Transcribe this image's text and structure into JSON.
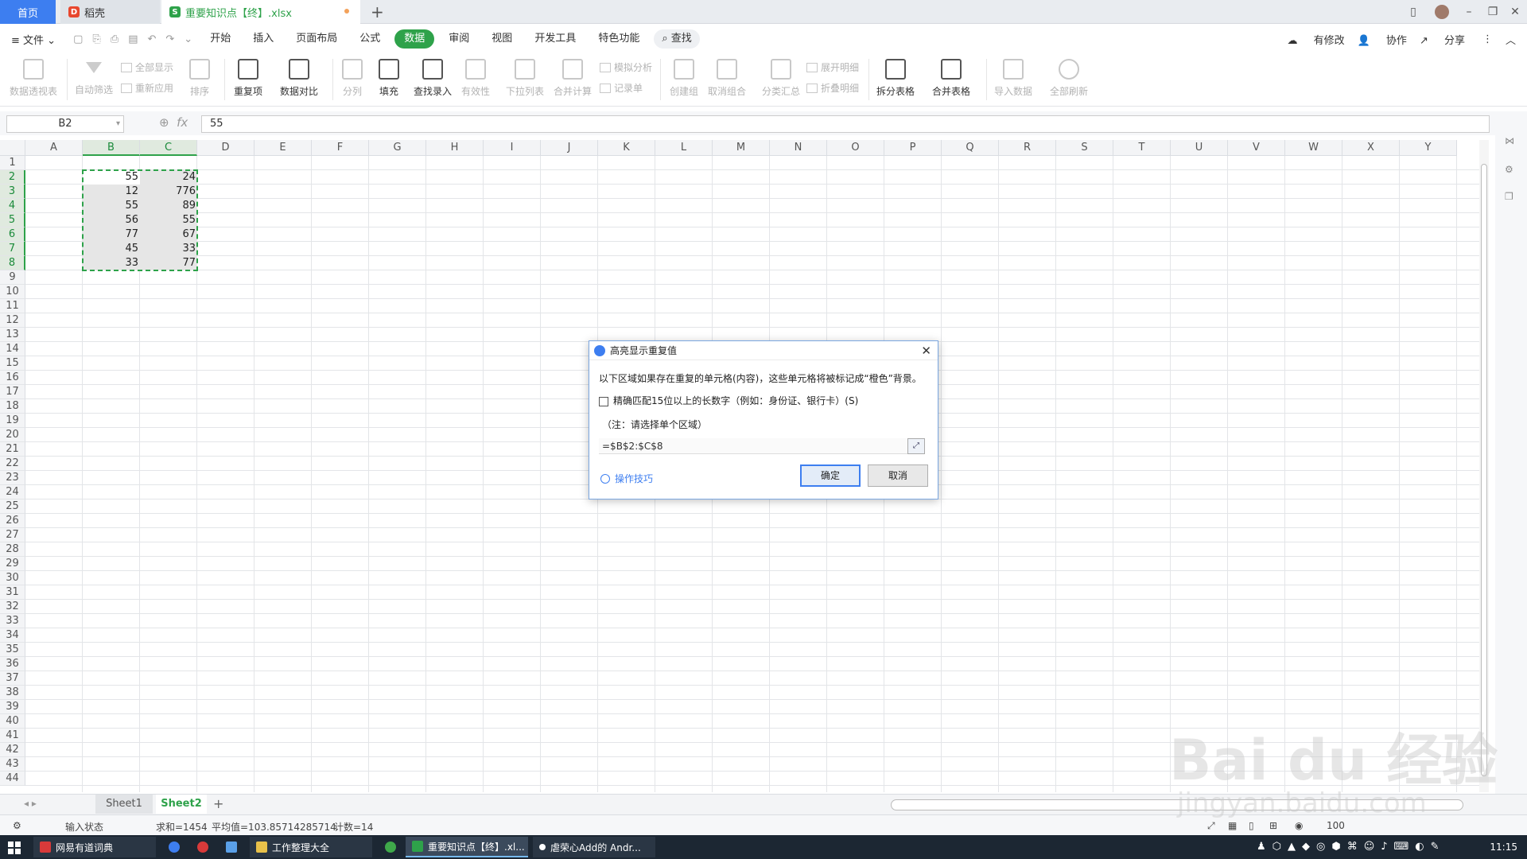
{
  "tabs": {
    "home": "首页",
    "daoke": "稻壳",
    "doc": "重要知识点【终】.xlsx"
  },
  "menu": {
    "file": "文件",
    "items": [
      "开始",
      "插入",
      "页面布局",
      "公式",
      "数据",
      "审阅",
      "视图",
      "开发工具",
      "特色功能"
    ],
    "active": "数据",
    "search": "查找",
    "right": [
      "有修改",
      "协作",
      "分享"
    ]
  },
  "ribbon": {
    "big": [
      "数据透视表",
      "自动筛选",
      "排序",
      "重复项",
      "数据对比",
      "分列",
      "填充",
      "查找录入",
      "有效性",
      "下拉列表",
      "合并计算",
      "创建组",
      "取消组合",
      "分类汇总",
      "拆分表格",
      "合并表格",
      "导入数据",
      "全部刷新"
    ],
    "small": [
      "全部显示",
      "重新应用",
      "模拟分析",
      "记录单",
      "展开明细",
      "折叠明细"
    ]
  },
  "formula_bar": {
    "name_box": "B2",
    "fx": "fx",
    "value": "55"
  },
  "columns": [
    "A",
    "B",
    "C",
    "D",
    "E",
    "F",
    "G",
    "H",
    "I",
    "J",
    "K",
    "L",
    "M",
    "N",
    "O",
    "P",
    "Q",
    "R",
    "S",
    "T",
    "U",
    "V",
    "W",
    "X",
    "Y"
  ],
  "rows": [
    "1",
    "2",
    "3",
    "4",
    "5",
    "6",
    "7",
    "8",
    "9",
    "10",
    "11",
    "12",
    "13",
    "14",
    "15",
    "16",
    "17",
    "18",
    "19",
    "20",
    "21",
    "22",
    "23",
    "24",
    "25",
    "26",
    "27",
    "28",
    "29",
    "30",
    "31",
    "32",
    "33",
    "34",
    "35",
    "36",
    "37",
    "38",
    "39",
    "40",
    "41",
    "42",
    "43",
    "44"
  ],
  "cells": {
    "B": [
      "55",
      "12",
      "55",
      "56",
      "77",
      "45",
      "33"
    ],
    "C": [
      "24",
      "776",
      "89",
      "55",
      "67",
      "33",
      "77"
    ]
  },
  "dialog": {
    "title": "高亮显示重复值",
    "description": "以下区域如果存在重复的单元格(内容)，这些单元格将被标记成“橙色”背景。",
    "checkbox_label": "精确匹配15位以上的长数字（例如：身份证、银行卡）(S)",
    "note": "（注：请选择单个区域）",
    "range": "=$B$2:$C$8",
    "tips": "操作技巧",
    "ok": "确定",
    "cancel": "取消"
  },
  "sheets": [
    "Sheet1",
    "Sheet2"
  ],
  "active_sheet": "Sheet2",
  "status": {
    "mode": "输入状态",
    "sum": "求和=1454",
    "avg": "平均值=103.85714285714",
    "count": "计数=14",
    "zoom": "100"
  },
  "taskbar": {
    "items": [
      "网易有道词典",
      "工作整理大全",
      "重要知识点【终】.xl...",
      "虐荣心Add的 Andr..."
    ],
    "clock": "11:15"
  },
  "watermark": {
    "logo": "Bai du 经验",
    "url": "jingyan.baidu.com"
  }
}
